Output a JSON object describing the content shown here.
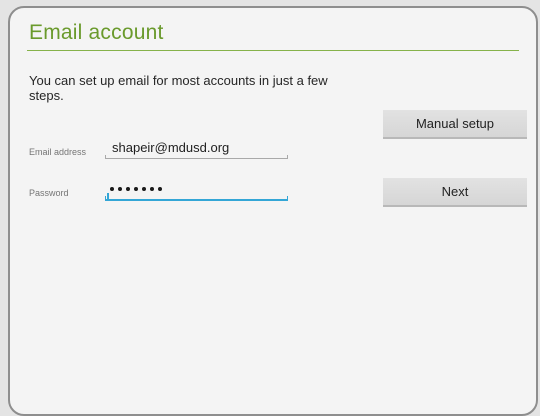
{
  "header": {
    "title": "Email account"
  },
  "intro_text": "You can set up email for most accounts in just a few steps.",
  "form": {
    "email": {
      "label": "Email address",
      "value": "shapeir@mdusd.org"
    },
    "password": {
      "label": "Password",
      "masked_length": 7
    }
  },
  "buttons": {
    "manual_setup": "Manual setup",
    "next": "Next"
  },
  "colors": {
    "title": "#6a9a2c",
    "focus_underline": "#33a6d6"
  }
}
